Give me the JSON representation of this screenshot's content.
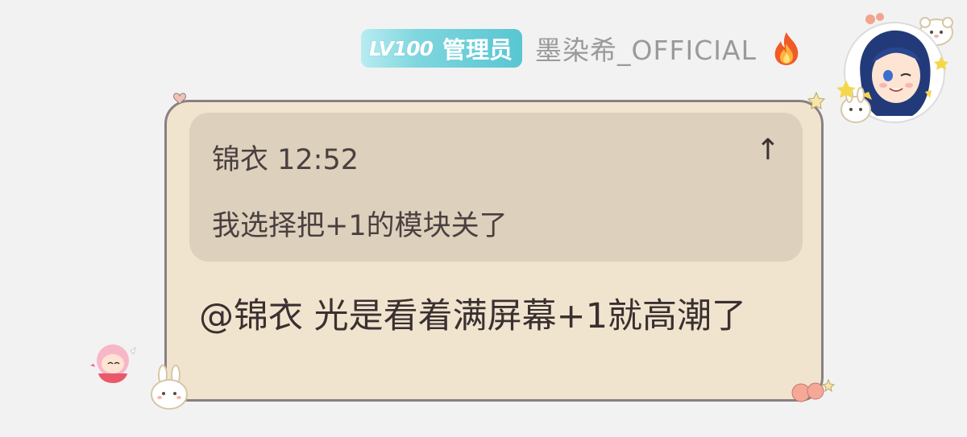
{
  "sender": {
    "level_badge": "LV100",
    "role": "管理员",
    "name": "墨染希_OFFICIAL",
    "flame_icon": "fire-icon",
    "avatar_icon": "anime-avatar"
  },
  "reply_quote": {
    "author_time": "锦衣 12:52",
    "text": "我选择把+1的模块关了",
    "jump_icon": "arrow-up-icon",
    "jump_glyph": "↑"
  },
  "message": {
    "text": "@锦衣 光是看着满屏幕+1就高潮了"
  },
  "colors": {
    "badge": "#58c6d2",
    "bubble_bg": "#f1e4cf",
    "quote_bg": "#ddd0bc",
    "bubble_border": "#8a7f82"
  }
}
